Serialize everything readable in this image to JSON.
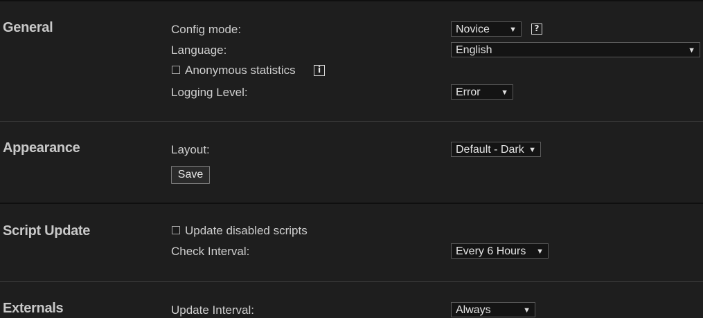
{
  "general": {
    "title": "General",
    "config_mode_label": "Config mode:",
    "config_mode_value": "Novice",
    "config_help_icon": "question-mark-icon",
    "language_label": "Language:",
    "language_value": "English",
    "anon_stats_label": "Anonymous statistics",
    "anon_stats_checked": false,
    "anon_info_icon": "info-icon",
    "logging_label": "Logging Level:",
    "logging_value": "Error"
  },
  "appearance": {
    "title": "Appearance",
    "layout_label": "Layout:",
    "layout_value": "Default - Dark",
    "save_label": "Save"
  },
  "script_update": {
    "title": "Script Update",
    "update_disabled_label": "Update disabled scripts",
    "update_disabled_checked": false,
    "check_interval_label": "Check Interval:",
    "check_interval_value": "Every 6 Hours"
  },
  "externals": {
    "title": "Externals",
    "update_interval_label": "Update Interval:",
    "update_interval_value": "Always"
  },
  "glyphs": {
    "dropdown_arrow": "▼",
    "help": "?",
    "info": "i"
  },
  "colors": {
    "background": "#1e1e1e",
    "text": "#cfcfcf",
    "select_bg": "#141414"
  }
}
